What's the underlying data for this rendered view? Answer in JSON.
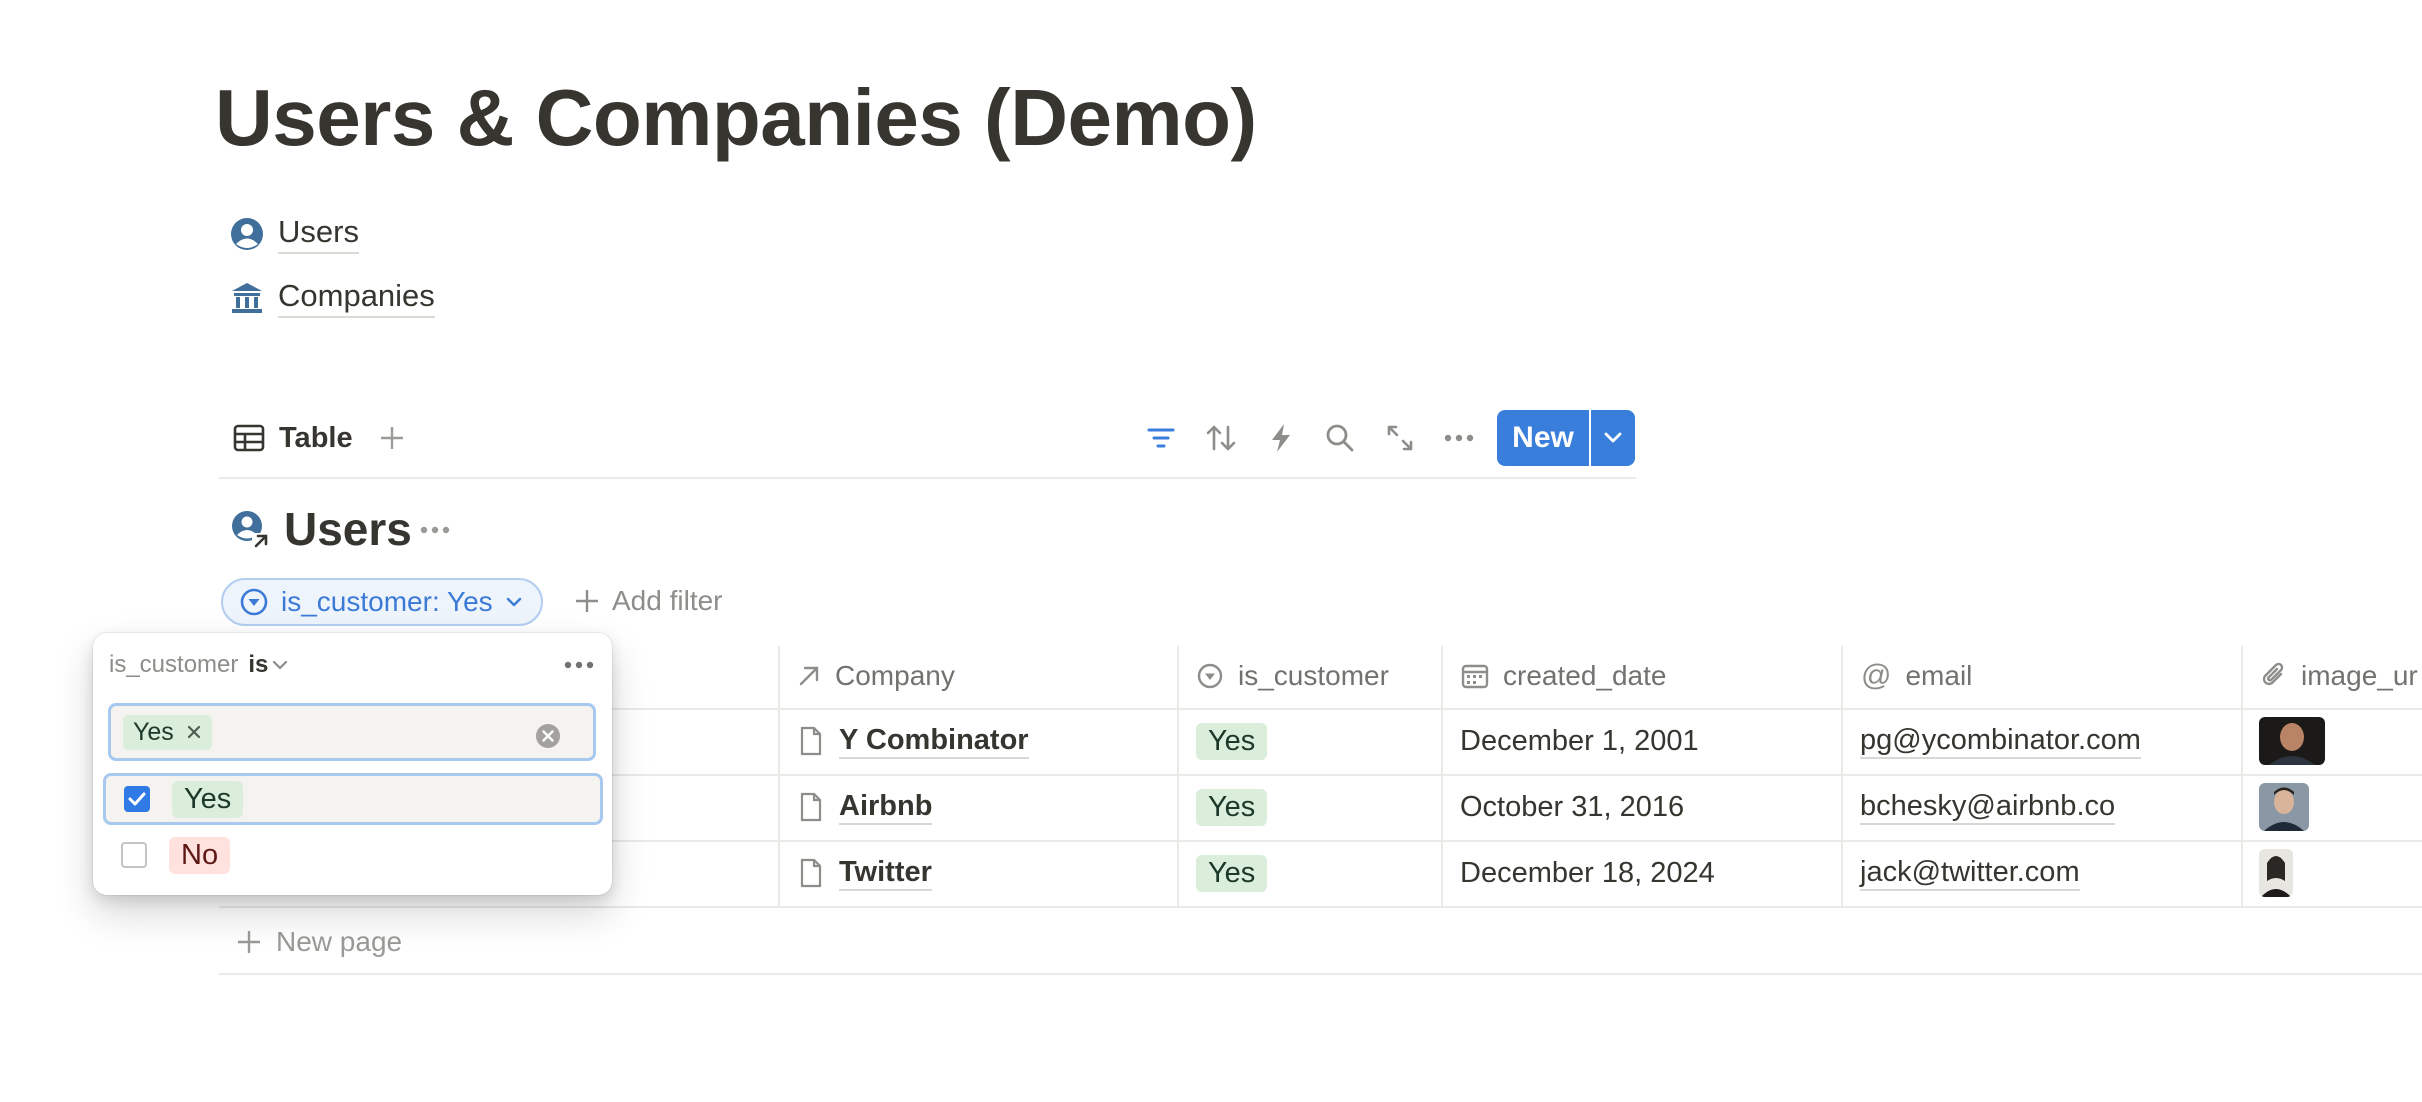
{
  "page": {
    "title": "Users & Companies (Demo)"
  },
  "links": [
    {
      "label": "Users",
      "icon": "user-circle-icon"
    },
    {
      "label": "Companies",
      "icon": "bank-icon"
    }
  ],
  "toolbar": {
    "view_label": "Table",
    "new_label": "New",
    "icons": [
      "filter-icon",
      "sort-icon",
      "automation-icon",
      "search-icon",
      "expand-icon",
      "more-icon"
    ]
  },
  "database": {
    "title": "Users",
    "filter_chip": "is_customer: Yes",
    "add_filter": "Add filter",
    "columns": [
      {
        "label": "Company",
        "icon": "relation-arrow-icon"
      },
      {
        "label": "is_customer",
        "icon": "select-icon"
      },
      {
        "label": "created_date",
        "icon": "calendar-icon"
      },
      {
        "label": "email",
        "icon": "at-icon"
      },
      {
        "label": "image_ur",
        "icon": "paperclip-icon"
      }
    ],
    "rows": [
      {
        "company": "Y Combinator",
        "is_customer": "Yes",
        "created_date": "December 1, 2001",
        "email": "pg@ycombinator.com"
      },
      {
        "company": "Airbnb",
        "is_customer": "Yes",
        "created_date": "October 31, 2016",
        "email": "bchesky@airbnb.co"
      },
      {
        "company": "Twitter",
        "is_customer": "Yes",
        "created_date": "December 18, 2024",
        "email": "jack@twitter.com"
      }
    ],
    "new_page": "New page"
  },
  "popover": {
    "property": "is_customer",
    "operator": "is",
    "selected_tag": "Yes",
    "options": [
      {
        "label": "Yes",
        "checked": true
      },
      {
        "label": "No",
        "checked": false
      }
    ]
  },
  "colors": {
    "accent": "#3a7edc",
    "yes_tag": "#dbeddb",
    "no_tag": "#ffe2dd"
  }
}
